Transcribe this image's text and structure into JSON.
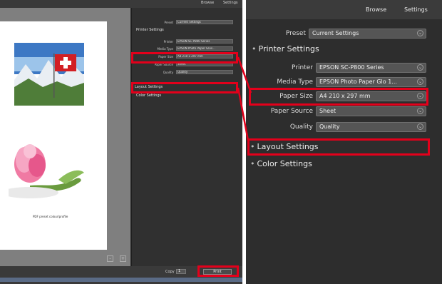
{
  "left": {
    "topbar": {
      "browse_label": "Browse",
      "settings_label": "Settings"
    },
    "preview": {
      "caption": "PDF preset colour/profile"
    },
    "zoom": {
      "zoom_in_label": "+",
      "zoom_out_label": "-"
    },
    "sidebar": {
      "preset_label": "Preset",
      "preset_value": "Current Settings",
      "printer_settings": "Printer Settings",
      "printer_label": "Printer",
      "printer_value": "EPSON SC-P800 Series",
      "media_label": "Media Type",
      "media_value": "EPSON Photo Paper Glos...",
      "paper_label": "Paper Size",
      "paper_value": "A4 210 x 297 mm",
      "source_label": "Paper Source",
      "source_value": "Sheet",
      "quality_label": "Quality",
      "quality_value": "Quality",
      "layout_settings": "Layout Settings",
      "color_settings": "Color Settings"
    },
    "bottombar": {
      "copies_label": "Copy",
      "copies_value": "1",
      "print_label": "Print"
    }
  },
  "right": {
    "topbar": {
      "browse_label": "Browse",
      "settings_label": "Settings"
    },
    "preset": {
      "label": "Preset",
      "value": "Current Settings"
    },
    "printer_settings": {
      "title": "Printer Settings"
    },
    "printer": {
      "label": "Printer",
      "value": "EPSON SC-P800 Series"
    },
    "media_type": {
      "label": "Media Type",
      "value": "EPSON Photo Paper Glo 1..."
    },
    "paper_size": {
      "label": "Paper Size",
      "value": "A4 210 x 297 mm"
    },
    "paper_source": {
      "label": "Paper Source",
      "value": "Sheet"
    },
    "quality": {
      "label": "Quality",
      "value": "Quality"
    },
    "layout_settings": {
      "title": "Layout Settings"
    },
    "color_settings": {
      "title": "Color Settings"
    },
    "bullet": "•",
    "chevron": "⌄"
  },
  "colors": {
    "highlight": "#e3001b",
    "panel": "#2d2d2d",
    "field": "#555555"
  },
  "icons": [
    "chevron-down-icon",
    "zoom-in-icon",
    "zoom-out-icon"
  ]
}
